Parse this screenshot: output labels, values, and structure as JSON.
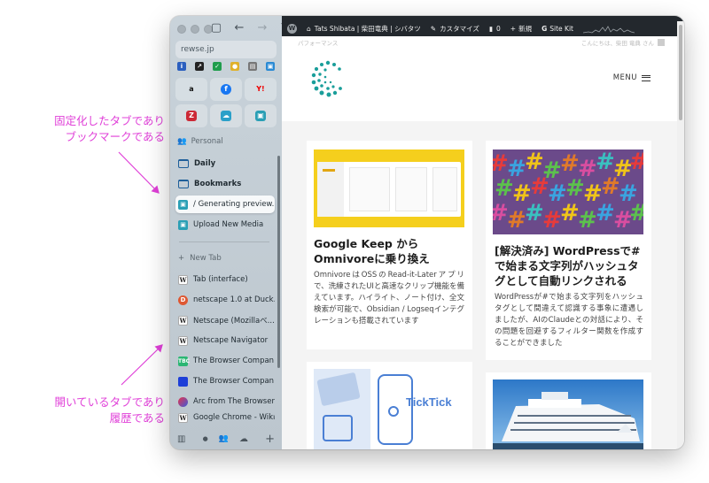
{
  "annotations": {
    "top": [
      "固定化したタブであり",
      "ブックマークである"
    ],
    "bottom": [
      "開いているタブであり",
      "履歴である"
    ],
    "color": "#e040d8"
  },
  "sidebar": {
    "url": "rewse.jp",
    "space_label": "Personal",
    "folders": [
      {
        "label": "Daily",
        "icon": "folder-icon"
      },
      {
        "label": "Bookmarks",
        "icon": "folder-icon"
      }
    ],
    "pinned_tabs": [
      {
        "label": "/ Generating preview...",
        "icon": "media-icon"
      },
      {
        "label": "Upload New Media",
        "icon": "media-icon"
      }
    ],
    "new_tab_label": "New Tab",
    "open_tabs": [
      {
        "label": "Tab (interface)",
        "icon": "wikipedia-icon"
      },
      {
        "label": "netscape 1.0 at Duck...",
        "icon": "duckduckgo-icon"
      },
      {
        "label": "Netscape (Mozillaべ...",
        "icon": "wikipedia-icon"
      },
      {
        "label": "Netscape Navigator",
        "icon": "wikipedia-icon"
      },
      {
        "label": "The Browser Compan...",
        "icon": "tbc-icon"
      },
      {
        "label": "The Browser Compan...",
        "icon": "tbc-blue-icon"
      },
      {
        "label": "Arc from The Browser...",
        "icon": "arc-icon"
      },
      {
        "label": "Google Chrome - Wiki...",
        "icon": "wikipedia-icon"
      }
    ]
  },
  "adminbar": {
    "site_name": "Tats Shibata | 柴田竜典 | シバタツ",
    "customize": "カスタマイズ",
    "comments": "0",
    "new": "新規",
    "sitekit": "Site Kit"
  },
  "subbar": {
    "left": "パフォーマンス",
    "right": "こんにちは、柴田 竜典 さん"
  },
  "header": {
    "menu_label": "MENU"
  },
  "cards": [
    {
      "title": "Google Keep からOmnivoreに乗り換え",
      "body": "OmnivoreはOSSのRead-it-Laterアプリで、洗練されたUIと高速なクリップ機能を備えています。ハイライト、ノート付け、全文検索が可能で、Obsidian / Logseqインテグレーションも搭載されています"
    },
    {
      "title": "[解決済み] WordPressで#で始まる文字列がハッシュタグとして自動リンクされる",
      "body": "WordPressが#で始まる文字列をハッシュタグとして間違えて認識する事象に遭遇しましたが、AIのClaudeとの対話により、その問題を回避するフィルター関数を作成することができました"
    },
    {
      "title": "",
      "body": "",
      "image_text": "TickTick"
    }
  ]
}
